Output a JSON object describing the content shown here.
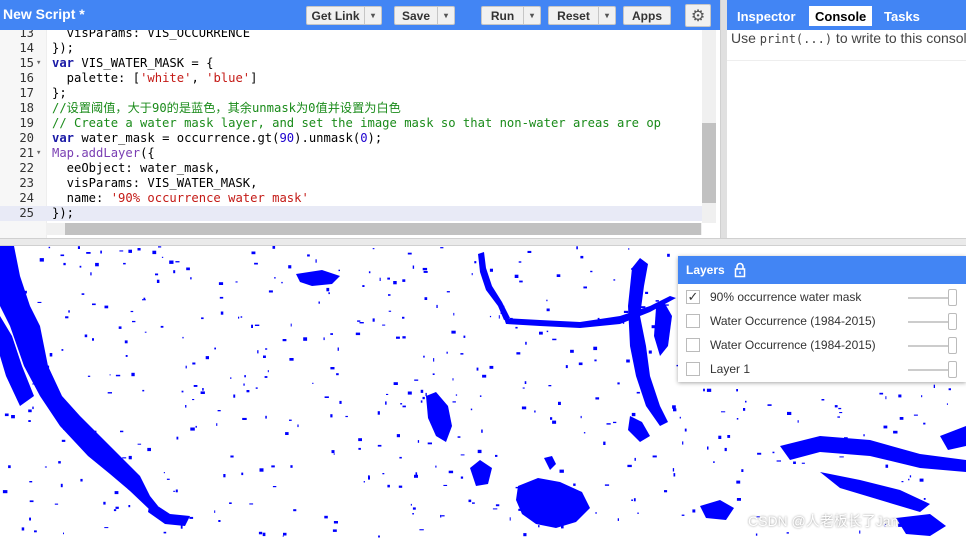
{
  "toolbar": {
    "script_title": "New Script *",
    "buttons": {
      "get_link": "Get Link",
      "save": "Save",
      "run": "Run",
      "reset": "Reset",
      "apps": "Apps"
    },
    "dropdown_glyph": "▾",
    "settings_icon": "⚙"
  },
  "editor": {
    "lines": [
      {
        "n": "13",
        "fold": "",
        "t": [
          [
            "",
            "  visParams: VIS_OCCURRENCE"
          ]
        ]
      },
      {
        "n": "14",
        "fold": "",
        "t": [
          [
            "",
            "});"
          ]
        ]
      },
      {
        "n": "15",
        "fold": "▾",
        "t": [
          [
            "k",
            "var"
          ],
          [
            "",
            " VIS_WATER_MASK = {"
          ]
        ]
      },
      {
        "n": "16",
        "fold": "",
        "t": [
          [
            "",
            "  palette: ["
          ],
          [
            "s",
            "'white'"
          ],
          [
            "",
            ", "
          ],
          [
            "s",
            "'blue'"
          ],
          [
            "",
            "]"
          ]
        ]
      },
      {
        "n": "17",
        "fold": "",
        "t": [
          [
            "",
            "};"
          ]
        ]
      },
      {
        "n": "18",
        "fold": "",
        "t": [
          [
            "c",
            "//设置阈值，大于90的是蓝色，其余unmask为0值并设置为白色"
          ]
        ]
      },
      {
        "n": "19",
        "fold": "",
        "t": [
          [
            "c",
            "// Create a water mask layer, and set the image mask so that non-water areas are op"
          ]
        ]
      },
      {
        "n": "20",
        "fold": "",
        "t": [
          [
            "k",
            "var"
          ],
          [
            "",
            " water_mask = occurrence.gt("
          ],
          [
            "n",
            "90"
          ],
          [
            "",
            ").unmask("
          ],
          [
            "n",
            "0"
          ],
          [
            "",
            ");"
          ]
        ]
      },
      {
        "n": "21",
        "fold": "▾",
        "t": [
          [
            "p",
            "Map.addLayer"
          ],
          [
            "",
            "({"
          ]
        ]
      },
      {
        "n": "22",
        "fold": "",
        "t": [
          [
            "",
            "  eeObject: water_mask,"
          ]
        ]
      },
      {
        "n": "23",
        "fold": "",
        "t": [
          [
            "",
            "  visParams: VIS_WATER_MASK,"
          ]
        ]
      },
      {
        "n": "24",
        "fold": "",
        "t": [
          [
            "",
            "  name: "
          ],
          [
            "s",
            "'90% occurrence water mask'"
          ]
        ]
      },
      {
        "n": "25",
        "fold": "",
        "t": [
          [
            "",
            "});"
          ]
        ]
      }
    ]
  },
  "right_panel": {
    "tabs": [
      "Inspector",
      "Console",
      "Tasks"
    ],
    "active_tab": "Console",
    "console_text": {
      "before": "Use ",
      "code": "print(...)",
      "after": " to write to this console"
    }
  },
  "layers": {
    "title": "Layers",
    "items": [
      {
        "name": "90% occurrence water mask",
        "checked": true,
        "check_glyph": "✓"
      },
      {
        "name": "Water Occurrence (1984-2015)",
        "checked": false
      },
      {
        "name": "Water Occurrence (1984-2015)",
        "checked": false
      },
      {
        "name": "Layer 1",
        "checked": false
      }
    ]
  },
  "watermark": "CSDN @人老板长了Jan",
  "colors": {
    "accent": "#4285f4",
    "water": "#0000ff",
    "comment": "#1a8b1a",
    "keyword": "#1a1aa6",
    "string": "#c41a16"
  }
}
